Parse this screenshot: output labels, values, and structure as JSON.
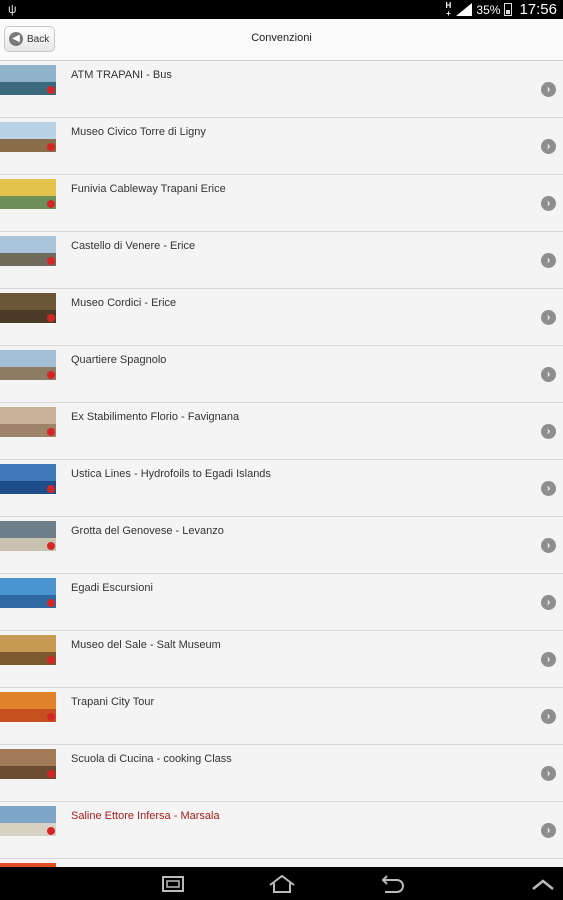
{
  "status_bar": {
    "network": "H",
    "battery_percent": "35%",
    "time": "17:56"
  },
  "header": {
    "back_label": "Back",
    "title": "Convenzioni"
  },
  "items": [
    {
      "name": "ATM TRAPANI - Bus",
      "thumb": [
        "#8fb1c9",
        "#3a6a7c"
      ]
    },
    {
      "name": "Museo Civico Torre di Ligny",
      "thumb": [
        "#b9d2e6",
        "#8a6e4c"
      ]
    },
    {
      "name": "Funivia Cableway Trapani Erice",
      "thumb": [
        "#e3c14a",
        "#6f8f5a"
      ]
    },
    {
      "name": "Castello di Venere - Erice",
      "thumb": [
        "#a9c3d8",
        "#6e6a5c"
      ]
    },
    {
      "name": "Museo Cordici - Erice",
      "thumb": [
        "#6b5638",
        "#4b3b27"
      ]
    },
    {
      "name": "Quartiere Spagnolo",
      "thumb": [
        "#a3bfd6",
        "#8c7c63"
      ]
    },
    {
      "name": "Ex Stabilimento Florio - Favignana",
      "thumb": [
        "#c8b196",
        "#9d8468"
      ]
    },
    {
      "name": "Ustica Lines - Hydrofoils to Egadi Islands",
      "thumb": [
        "#3f78b8",
        "#1d4e8a"
      ]
    },
    {
      "name": "Grotta del Genovese - Levanzo",
      "thumb": [
        "#6d7e88",
        "#c9c2b0"
      ]
    },
    {
      "name": "Egadi Escursioni",
      "thumb": [
        "#4a94cf",
        "#2f6aa3"
      ]
    },
    {
      "name": "Museo del Sale - Salt Museum",
      "thumb": [
        "#c79a54",
        "#7d5a2e"
      ]
    },
    {
      "name": "Trapani City Tour",
      "thumb": [
        "#e0822a",
        "#c7511e"
      ]
    },
    {
      "name": "Scuola di Cucina - cooking Class",
      "thumb": [
        "#a27a56",
        "#6c4c31"
      ]
    },
    {
      "name": "Saline Ettore Infersa - Marsala",
      "thumb": [
        "#7fa6c9",
        "#d8d2c4"
      ],
      "highlight": true
    },
    {
      "name": "",
      "thumb": [
        "#e34d1f",
        "#c53319"
      ]
    }
  ]
}
